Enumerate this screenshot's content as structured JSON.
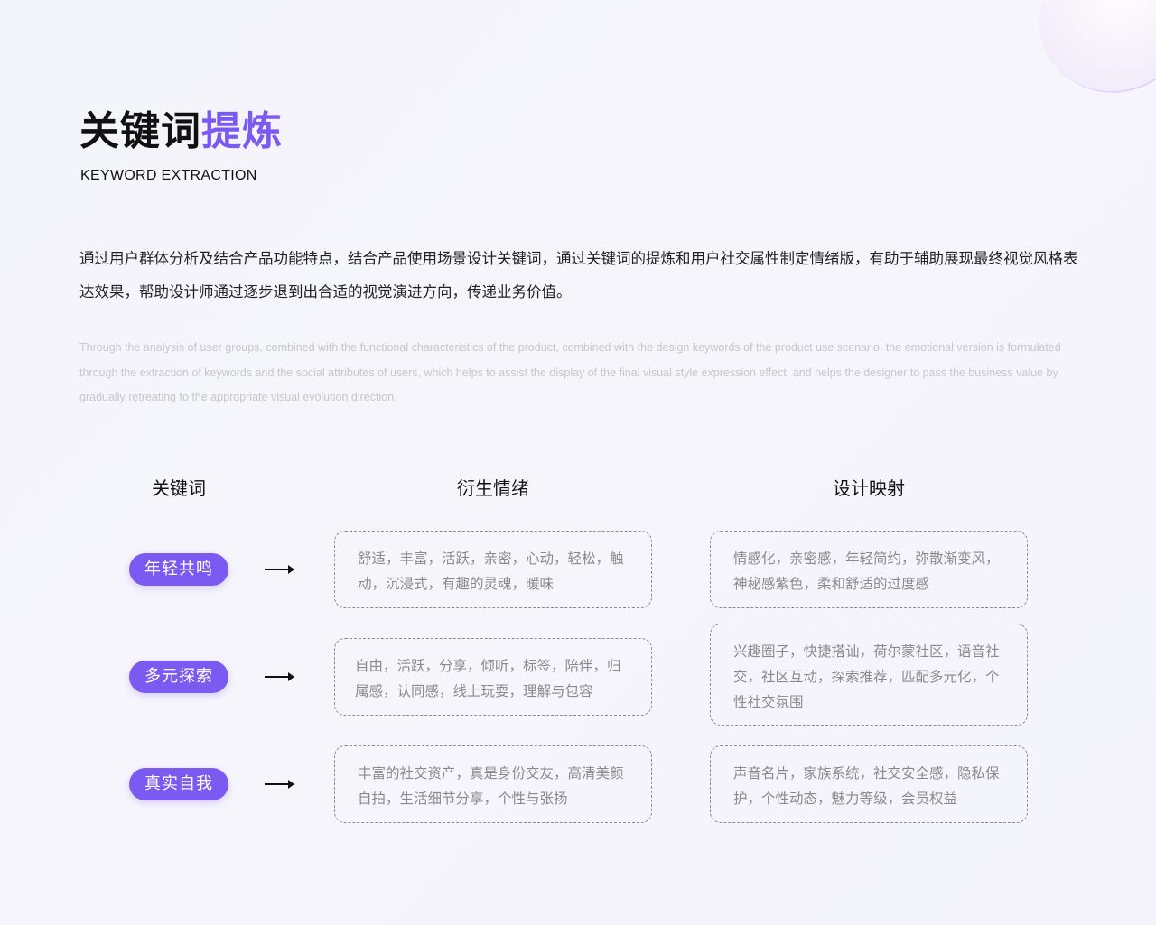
{
  "header": {
    "title_main": "关键词",
    "title_accent": "提炼",
    "subtitle": "KEYWORD EXTRACTION"
  },
  "intro": {
    "zh": "通过用户群体分析及结合产品功能特点，结合产品使用场景设计关键词，通过关键词的提炼和用户社交属性制定情绪版，有助于辅助展现最终视觉风格表达效果，帮助设计师通过逐步退到出合适的视觉演进方向，传递业务价值。",
    "en": "Through the analysis of user groups, combined with the functional characteristics of the product, combined with the design keywords of the product use scenario, the emotional version is formulated through the extraction of keywords and the social attributes of users, which helps to assist the display of the final visual style expression effect, and helps the designer to pass the business value by gradually retreating to the appropriate visual evolution direction."
  },
  "table": {
    "headers": [
      "关键词",
      "衍生情绪",
      "设计映射"
    ],
    "rows": [
      {
        "keyword": "年轻共鸣",
        "emotion": "舒适，丰富，活跃，亲密，心动，轻松，触动，沉浸式，有趣的灵魂，暖味",
        "mapping": "情感化，亲密感，年轻简约，弥散渐变风，神秘感紫色，柔和舒适的过度感"
      },
      {
        "keyword": "多元探索",
        "emotion": "自由，活跃，分享，倾听，标签，陪伴，归属感，认同感，线上玩耍，理解与包容",
        "mapping": "兴趣圈子，快捷搭讪，荷尔蒙社区，语音社交，社区互动，探索推荐，匹配多元化，个性社交氛围"
      },
      {
        "keyword": "真实自我",
        "emotion": "丰富的社交资产，真是身份交友，高清美颜自拍，生活细节分享，个性与张扬",
        "mapping": "声音名片，家族系统，社交安全感，隐私保护，个性动态，魅力等级，会员权益"
      }
    ]
  },
  "colors": {
    "accent": "#7a5af0",
    "text": "#111111",
    "muted": "#8a8a8a"
  },
  "icons": [
    "arrow-right-icon"
  ]
}
